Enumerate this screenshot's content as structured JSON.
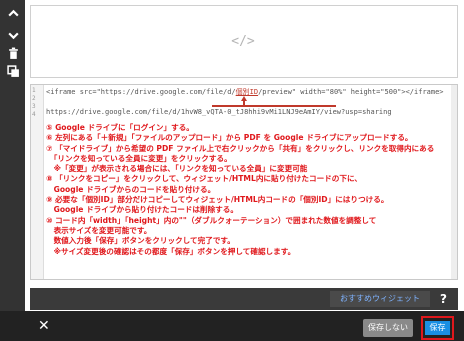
{
  "preview": {
    "icon": "</>"
  },
  "editor": {
    "line_numbers": [
      "1",
      "2",
      "3",
      "4"
    ],
    "code_line1_prefix": "<iframe src=\"https://drive.google.com/file/d/",
    "code_line1_highlight": "個別ID",
    "code_line1_suffix": "/preview\" width=\"80%\" height=\"500\"></iframe>",
    "code_line2": "https://drive.google.com/file/d/1hvW8_vQTA-0_tJ8hhi9vMi1LNJ9eAmIY/view?usp=sharing",
    "steps": [
      "⑤ Google ドライブに「ログイン」する。",
      "⑥ 左列にある「＋新規」「ファイルのアップロード」から PDF を Google ドライブにアップロードする。",
      "⑦ 「マイドライブ」から希望の PDF ファイル上で右クリックから「共有」をクリックし、リンクを取得内にある",
      "　「リンクを知っている全員に変更」をクリックする。",
      "　※「変更」が表示される場合には、「リンクを知っている全員」に変更可能",
      "⑧ 「リンクをコピー」をクリックして、ウィジェット/HTML内に貼り付けたコードの下に、",
      "　Google ドライブからのコードを貼り付ける。",
      "⑨ 必要な「個別ID」部分だけコピーしてウィジェット/HTML内コードの「個別ID」にはりつける。",
      "　Google ドライブから貼り付けたコードは削除する。",
      "⑩ コード内「width」「height」内の\"\"（ダブルクォーテーション）で囲まれた数値を調整して",
      "　表示サイズを変更可能です。",
      "　数値入力後「保存」ボタンをクリックして完了です。",
      "　※サイズ変更後の確認はその都度「保存」ボタンを押して確認します。"
    ]
  },
  "recommend": {
    "widgets_label": "おすすめウィジェット",
    "help_label": "?"
  },
  "footer": {
    "close_label": "✕",
    "nosave_label": "保存しない",
    "save_label": "保存"
  },
  "colors": {
    "accent_red": "#e0181c",
    "save_blue": "#1a8fe3"
  }
}
